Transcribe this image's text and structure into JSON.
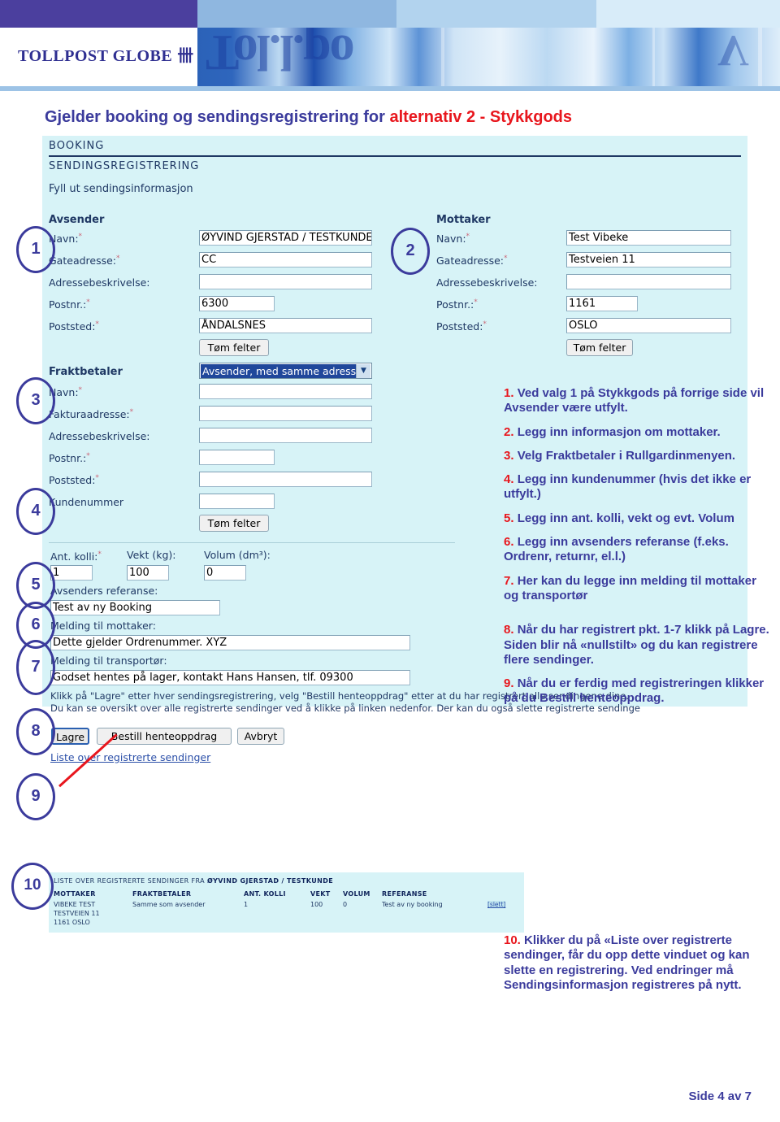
{
  "header": {
    "logo_text": "TOLLPOST GLOBE",
    "logo_mark": "卌",
    "ghost_text_1": "Tol.l.po",
    "ghost_text_2": "V"
  },
  "title": {
    "prefix": "Gjelder booking og sendingsregistrering for ",
    "highlight": "alternativ 2 - Stykkgods"
  },
  "screenshot": {
    "section_booking": "BOOKING",
    "section_sendingsregistrering": "SENDINGSREGISTRERING",
    "section_fyll": "Fyll ut sendingsinformasjon",
    "avsender": {
      "group_title": "Avsender",
      "labels": {
        "navn": "Navn:",
        "gateadresse": "Gateadresse:",
        "adressebeskrivelse": "Adressebeskrivelse:",
        "postnr": "Postnr.:",
        "poststed": "Poststed:"
      },
      "values": {
        "navn": "ØYVIND GJERSTAD / TESTKUNDE",
        "gateadresse": "CC",
        "adressebeskrivelse": "",
        "postnr": "6300",
        "poststed": "ÅNDALSNES"
      },
      "clear_button": "Tøm felter"
    },
    "mottaker": {
      "group_title": "Mottaker",
      "labels": {
        "navn": "Navn:",
        "gateadresse": "Gateadresse:",
        "adressebeskrivelse": "Adressebeskrivelse:",
        "postnr": "Postnr.:",
        "poststed": "Poststed:"
      },
      "values": {
        "navn": "Test Vibeke",
        "gateadresse": "Testveien 11",
        "adressebeskrivelse": "",
        "postnr": "1161",
        "poststed": "OSLO"
      },
      "clear_button": "Tøm felter"
    },
    "fraktbetaler": {
      "group_title": "Fraktbetaler",
      "dropdown_value": "Avsender, med samme adresse",
      "labels": {
        "navn": "Navn:",
        "fakturaadresse": "Fakturaadresse:",
        "adressebeskrivelse": "Adressebeskrivelse:",
        "postnr": "Postnr.:",
        "poststed": "Poststed:",
        "kundenummer": "Kundenummer"
      },
      "values": {
        "navn": "",
        "fakturaadresse": "",
        "adressebeskrivelse": "",
        "postnr": "",
        "poststed": "",
        "kundenummer": ""
      },
      "clear_button": "Tøm felter"
    },
    "shipment": {
      "labels": {
        "ant_kolli": "Ant. kolli:",
        "vekt": "Vekt (kg):",
        "volum": "Volum (dm³):",
        "avsenders_referanse": "Avsenders referanse:",
        "melding_mottaker": "Melding til mottaker:",
        "melding_transportor": "Melding til transportør:"
      },
      "values": {
        "ant_kolli": "1",
        "vekt": "100",
        "volum": "0",
        "avsenders_referanse": "Test av ny Booking",
        "melding_mottaker": "Dette gjelder Ordrenummer. XYZ",
        "melding_transportor": "Godset hentes på lager, kontakt Hans Hansen, tlf. 09300"
      }
    },
    "help_line_1": "Klikk på \"Lagre\" etter hver sendingsregistrering, velg \"Bestill henteoppdrag\" etter at du har registrert alle sendingene dine.",
    "help_line_2": "Du kan se oversikt over alle registrerte sendinger ved å klikke på linken nedenfor. Der kan du også slette registrerte sendinge",
    "buttons": {
      "lagre": "Lagre",
      "bestill": "Bestill henteoppdrag",
      "avbryt": "Avbryt"
    },
    "list_link": "Liste over registrerte sendinger"
  },
  "list_window": {
    "title_prefix": "LISTE OVER REGISTRERTE SENDINGER FRA ",
    "title_customer": "ØYVIND GJERSTAD / TESTKUNDE",
    "headers": [
      "MOTTAKER",
      "FRAKTBETALER",
      "ANT. KOLLI",
      "VEKT",
      "VOLUM",
      "REFERANSE"
    ],
    "row": {
      "mottaker_line1": "VIBEKE TEST",
      "mottaker_line2": "TESTVEIEN 11",
      "mottaker_line3": "1161 OSLO",
      "fraktbetaler": "Samme som avsender",
      "ant_kolli": "1",
      "vekt": "100",
      "volum": "0",
      "referanse": "Test av ny booking",
      "delete_link": "[slett]"
    }
  },
  "callouts": [
    "1",
    "2",
    "3",
    "4",
    "5",
    "6",
    "7",
    "8",
    "9",
    "10"
  ],
  "steps": [
    {
      "n": "1.",
      "text": "Ved valg 1 på Stykkgods på forrige side vil Avsender være utfylt."
    },
    {
      "n": "2.",
      "text": "Legg inn informasjon om mottaker."
    },
    {
      "n": "3.",
      "text": "Velg Fraktbetaler i Rullgardinmenyen."
    },
    {
      "n": "4.",
      "text": "Legg inn kundenummer (hvis det ikke er utfylt.)"
    },
    {
      "n": "5.",
      "text": "Legg inn ant. kolli, vekt og evt. Volum"
    },
    {
      "n": "6.",
      "text": "Legg inn avsenders referanse (f.eks. Ordrenr, returnr, el.l.)"
    },
    {
      "n": "7.",
      "text": "Her kan du legge inn melding til mottaker og transportør"
    },
    {
      "n": "8.",
      "text": "Når du har registrert pkt. 1-7 klikk på Lagre. Siden blir nå «nullstilt» og du kan registrere flere sendinger."
    },
    {
      "n": "9.",
      "text": "Når du er ferdig med registreringen klikker på du Bestill henteoppdrag."
    }
  ],
  "step10": {
    "n": "10.",
    "text": "Klikker du på «Liste over registrerte sendinger, får du opp dette vinduet og kan slette en registrering. Ved endringer må Sendingsinformasjon registreres på nytt."
  },
  "footer": {
    "page": "Side 4 av 7"
  }
}
